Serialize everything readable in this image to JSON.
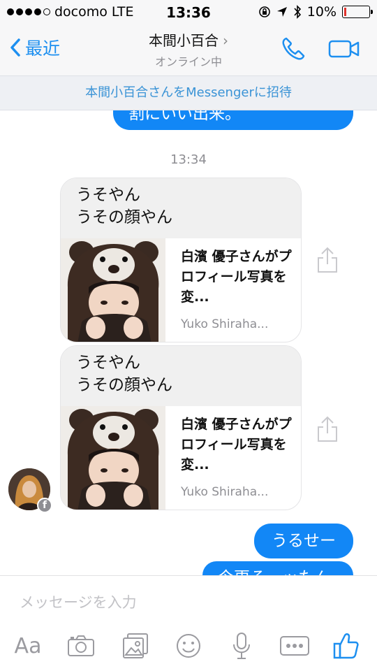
{
  "status_bar": {
    "carrier": "docomo",
    "network": "LTE",
    "time": "13:36",
    "battery": "10%",
    "battery_level": 0.1
  },
  "header": {
    "back_label": "最近",
    "title": "本間小百合",
    "chevron": "›",
    "subtitle": "オンライン中",
    "invite_text": "本間小百合さんをMessengerに招待",
    "icons": [
      "phone-icon",
      "video-camera-icon"
    ]
  },
  "messages": {
    "partial_top": "割にいい出来。",
    "timestamp": "13:34",
    "cards": [
      {
        "text_line1": "うそやん",
        "text_line2": "うその顔やん",
        "link_title": "白濱 優子さんがプロフィール写真を変...",
        "link_source": "Yuko Shiraha..."
      },
      {
        "text_line1": "うそやん",
        "text_line2": "うその顔やん",
        "link_title": "白濱 優子さんがプロフィール写真を変...",
        "link_source": "Yuko Shiraha..."
      }
    ],
    "outgoing_1": "うるせー",
    "partial_bottom": "今更そ・ッたん"
  },
  "composer": {
    "placeholder": "メッセージを入力",
    "aa_label": "Aa",
    "tools": [
      "text-format-icon",
      "camera-icon",
      "photo-gallery-icon",
      "emoji-icon",
      "microphone-icon",
      "more-icon",
      "thumbs-up-icon"
    ]
  },
  "colors": {
    "accent": "#1287f6",
    "bar_background": "#f7f7f8",
    "incoming_bubble": "#f0f0f0"
  }
}
